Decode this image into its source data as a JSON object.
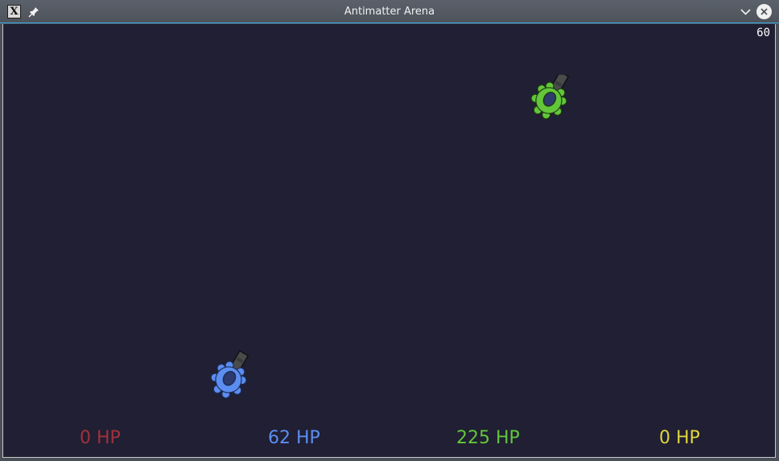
{
  "window": {
    "title": "Antimatter Arena",
    "app_icon_glyph": "X",
    "accent": "#3daee9"
  },
  "hud": {
    "fps": "60",
    "players": [
      {
        "label": "0 HP",
        "color": "#a1313b"
      },
      {
        "label": "62 HP",
        "color": "#5c8df0"
      },
      {
        "label": "225 HP",
        "color": "#63c63a"
      },
      {
        "label": "0 HP",
        "color": "#e0d43b"
      }
    ]
  },
  "tanks": [
    {
      "player": "blue",
      "color": "#5c8df0"
    },
    {
      "player": "green",
      "color": "#63c63a"
    }
  ],
  "colors": {
    "arena_bg": "#201f33",
    "barrel": "#4b4b4b",
    "cockpit": "#2e3a6e"
  }
}
